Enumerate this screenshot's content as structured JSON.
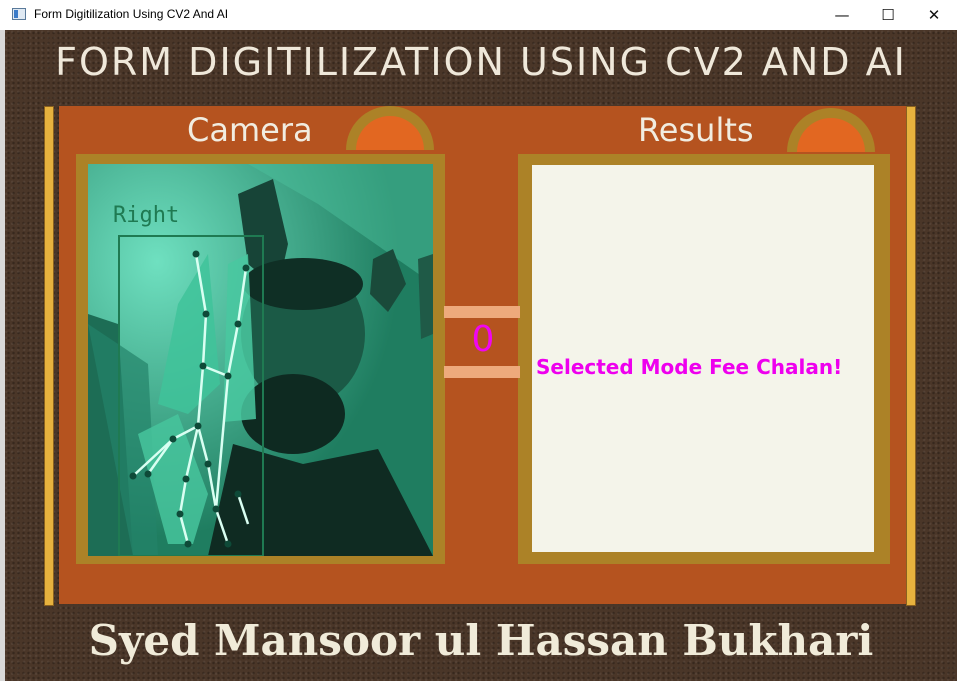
{
  "window": {
    "title": "Form Digitilization Using CV2 And AI",
    "minimize_glyph": "—",
    "maximize_glyph": "☐",
    "close_glyph": "✕"
  },
  "app": {
    "heading": "FORM DIGITILIZATION USING CV2 AND AI",
    "camera_label": "Camera",
    "results_label": "Results",
    "mode_value": "0",
    "mode_text": "Selected Mode Fee Chalan!",
    "footer": "Syed Mansoor ul Hassan Bukhari"
  },
  "camera": {
    "hand_label": "Right"
  },
  "colors": {
    "board": "#b5531f",
    "frame": "#ac8227",
    "tab": "#e26721",
    "accent_magenta": "#ee00ee",
    "results_bg": "#f4f4ea",
    "camera_tint": "#2f9c7c"
  }
}
